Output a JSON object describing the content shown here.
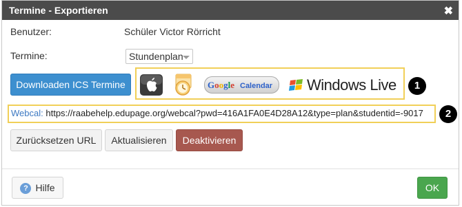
{
  "window": {
    "title": "Termine - Exportieren",
    "close_icon": "close-icon"
  },
  "form": {
    "user_label": "Benutzer:",
    "user_value": "Schüler Victor Rörricht",
    "termine_label": "Termine:",
    "termine_selected": "Stundenplan"
  },
  "buttons": {
    "download": "Downloaden ICS Termine",
    "reset_url": "Zurücksetzen URL",
    "refresh": "Aktualisieren",
    "deactivate": "Deaktivieren",
    "help": "Hilfe",
    "ok": "OK"
  },
  "calendar_services": {
    "google_prefix": "Google",
    "google_suffix": "Calendar",
    "windows_live": "Windows Live"
  },
  "webcal": {
    "label": "Webcal:",
    "url": "https://raabehelp.edupage.org/webcal?pwd=416A1FA0E4D28A12&type=plan&studentid=-9017"
  },
  "callouts": {
    "one": "1",
    "two": "2"
  },
  "colors": {
    "title_bar": "#4b4b4b",
    "primary": "#3d8fcf",
    "danger": "#a7584f",
    "success": "#4aa64e",
    "highlight": "#f1cf57"
  }
}
